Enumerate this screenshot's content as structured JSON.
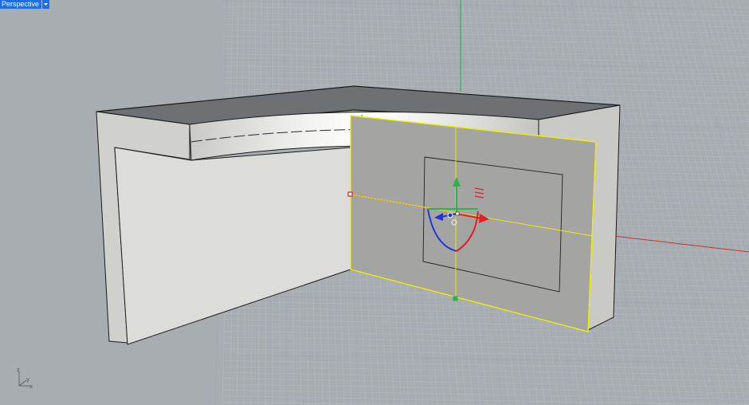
{
  "viewport": {
    "title": "Perspective",
    "dropdown_icon": "chevron-down-icon",
    "colors": {
      "background": "#a8adb2",
      "grid_minor": "#b7bcc0",
      "grid_major": "#9fa5aa",
      "x_axis": "#c8312e",
      "y_axis": "#2db34a",
      "selection": "#f0f000",
      "tab": "#1e6de4"
    }
  },
  "axes_widget": {
    "z_label": "z",
    "y_label": "y",
    "x_label": "x"
  },
  "gumball": {
    "icon": "gumball-widget-icon"
  }
}
